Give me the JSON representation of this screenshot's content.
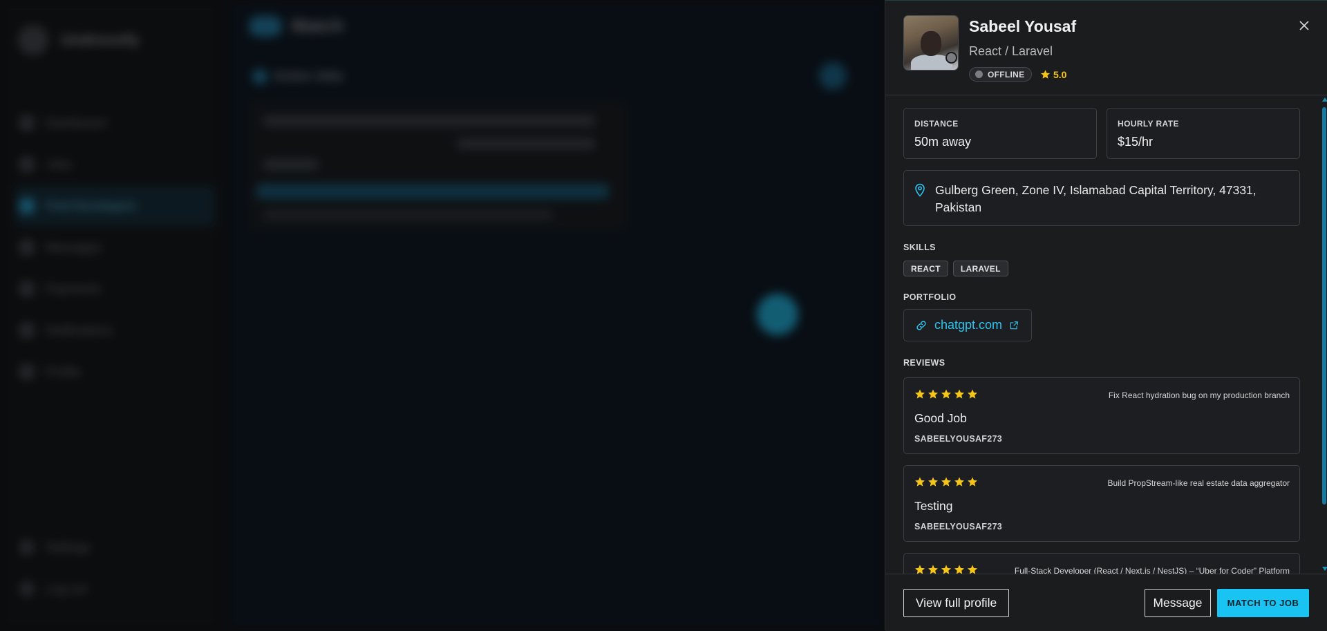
{
  "background": {
    "brand": "Undressify",
    "nav": [
      "Dashboard",
      "Jobs",
      "Find Developers",
      "Messages",
      "Payments",
      "Notifications",
      "Profile"
    ],
    "footer_nav": [
      "Settings",
      "Log out"
    ],
    "page_title": "Match",
    "section_title": "Active Jobs"
  },
  "drawer": {
    "profile": {
      "name": "Sabeel Yousaf",
      "role": "React / Laravel",
      "status": "OFFLINE",
      "rating": "5.0"
    },
    "stats": {
      "distance_label": "DISTANCE",
      "distance_value": "50m away",
      "rate_label": "HOURLY RATE",
      "rate_value": "$15/hr"
    },
    "address": "Gulberg Green, Zone IV, Islamabad Capital Territory, 47331, Pakistan",
    "skills_title": "SKILLS",
    "skills": [
      "REACT",
      "LARAVEL"
    ],
    "portfolio_title": "PORTFOLIO",
    "portfolio_link": "chatgpt.com",
    "reviews_title": "REVIEWS",
    "reviews": [
      {
        "job": "Fix React hydration bug on my production branch",
        "title": "Good Job",
        "user": "SABEELYOUSAF273",
        "stars": 5
      },
      {
        "job": "Build PropStream-like real estate data aggregator",
        "title": "Testing",
        "user": "SABEELYOUSAF273",
        "stars": 5
      },
      {
        "job": "Full-Stack Developer (React / Next.js / NestJS) – “Uber for Coder” Platform",
        "title": "",
        "user": "",
        "stars": 5
      }
    ],
    "footer": {
      "view_profile": "View full profile",
      "message": "Message",
      "match": "MATCH TO JOB"
    }
  },
  "colors": {
    "accent": "#19c4f2",
    "link": "#2ec4ef",
    "star": "#f5c518",
    "panel": "#1b1c1e",
    "border": "#3b3e43"
  },
  "icons": [
    "close-icon",
    "map-pin-icon",
    "link-icon",
    "external-link-icon",
    "star-icon"
  ]
}
